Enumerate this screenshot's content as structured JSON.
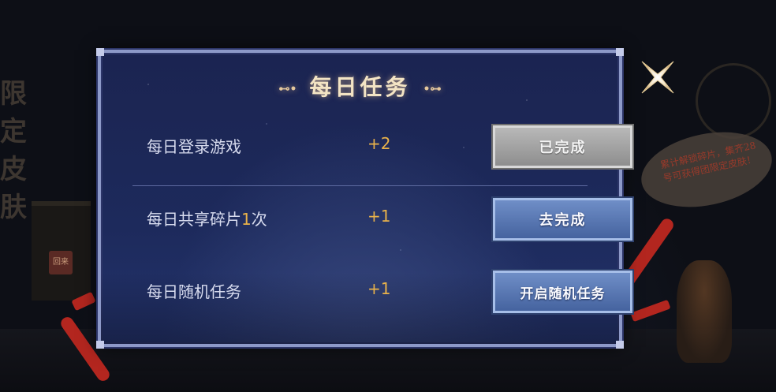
{
  "background": {
    "left_vertical_text": "限定皮肤",
    "hut_sign": "回来",
    "speech_bubble": "累计解锁碎片，集齐28号可获得团限定皮肤！"
  },
  "panel": {
    "title": "每日任务",
    "title_ornament_left": "⊷•",
    "title_ornament_right": "•⊶"
  },
  "tasks": [
    {
      "label": "每日登录游戏",
      "reward": "+2",
      "button": "已完成",
      "state": "done"
    },
    {
      "label_prefix": "每日共享碎片",
      "label_highlight": "1",
      "label_suffix": "次",
      "reward": "+1",
      "button": "去完成",
      "state": "todo"
    },
    {
      "label": "每日随机任务",
      "reward": "+1",
      "button": "开启随机任务",
      "state": "random"
    }
  ],
  "colors": {
    "panel_bg": "#1d2a5c",
    "panel_border": "#8d99c8",
    "reward": "#e9b24a",
    "btn_done": "#9e9e9e",
    "btn_active": "#5a78b3",
    "ribbon": "#b3261f"
  },
  "icons": {
    "close": "close-icon"
  }
}
